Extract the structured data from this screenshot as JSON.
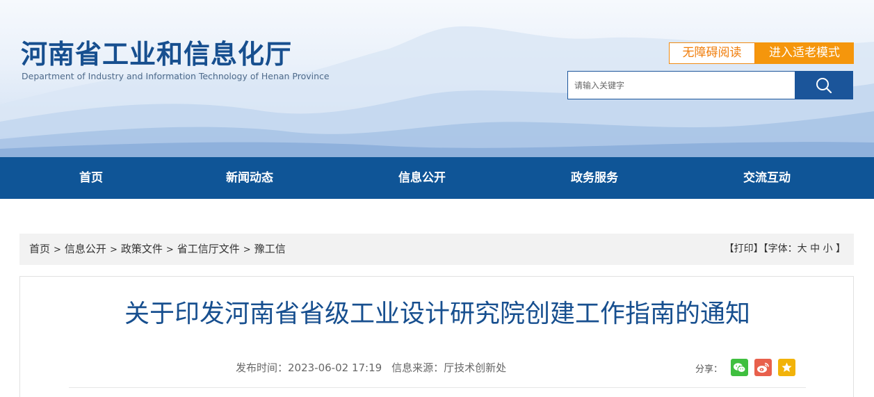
{
  "header": {
    "site_title": "河南省工业和信息化厅",
    "site_subtitle": "Department of Industry and Information Technology of Henan Province",
    "accessible_label": "无障碍阅读",
    "elder_mode_label": "进入适老模式",
    "search_placeholder": "请输入关键字",
    "search_icon": "search-icon"
  },
  "nav": {
    "items": [
      {
        "label": "首页"
      },
      {
        "label": "新闻动态"
      },
      {
        "label": "信息公开"
      },
      {
        "label": "政务服务"
      },
      {
        "label": "交流互动"
      }
    ]
  },
  "breadcrumb": {
    "items": [
      "首页",
      "信息公开",
      "政策文件",
      "省工信厅文件",
      "豫工信"
    ],
    "separator": ">"
  },
  "tools": {
    "print": "【打印】",
    "font_prefix": "【字体：",
    "font_large": "大",
    "font_medium": "中",
    "font_small": "小",
    "font_suffix": "】"
  },
  "article": {
    "title": "关于印发河南省省级工业设计研究院创建工作指南的通知",
    "publish_time": "发布时间：2023-06-02 17:19",
    "source": "信息来源：厅技术创新处",
    "share_label": "分享：",
    "share_icons": [
      "wechat-icon",
      "weibo-icon",
      "favorite-star-icon"
    ]
  },
  "colors": {
    "brand_blue": "#0f5597",
    "title_blue": "#174f8f",
    "accent_orange": "#f5960c",
    "wechat_green": "#3fbf3f",
    "weibo_red": "#e8604c",
    "star_yellow": "#f2b30a"
  }
}
